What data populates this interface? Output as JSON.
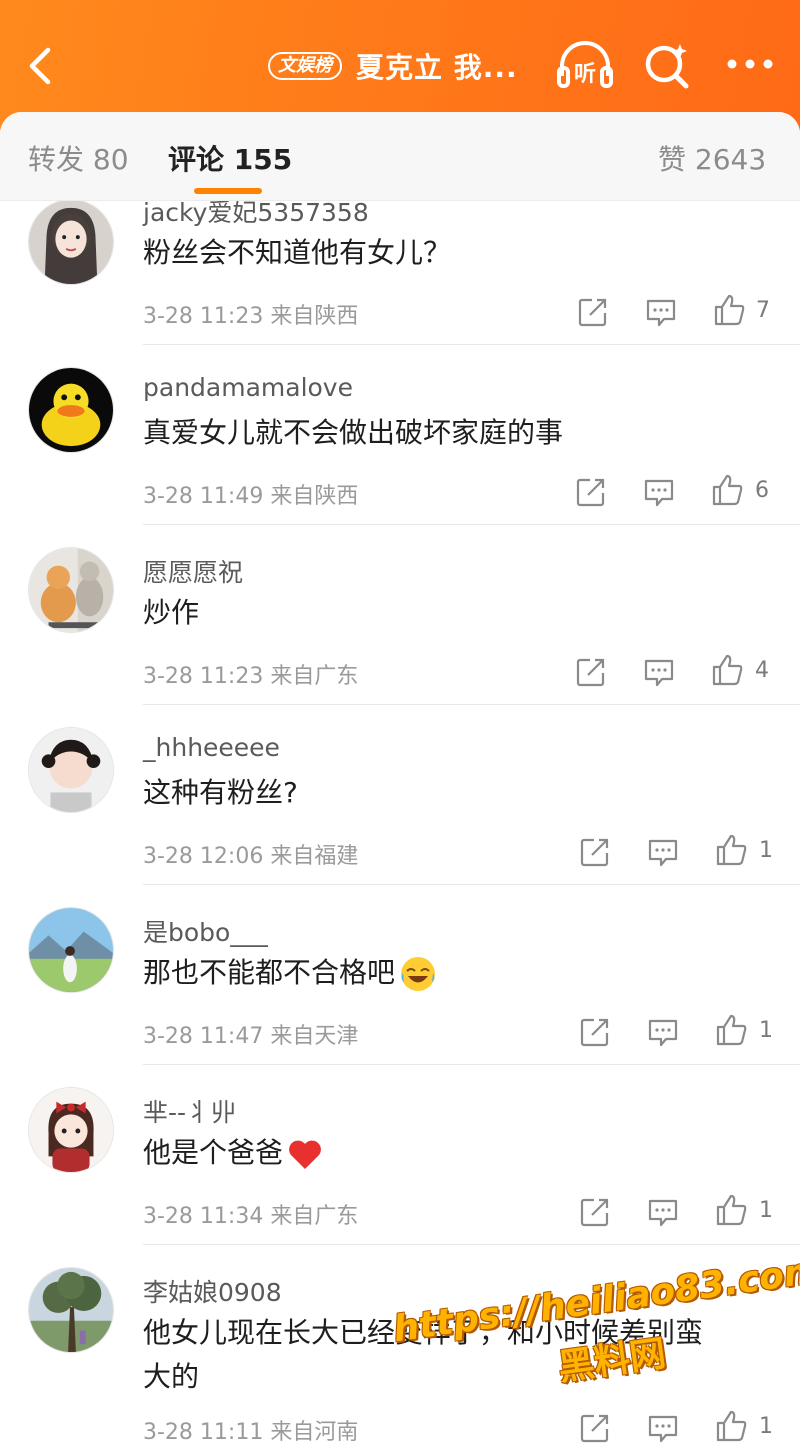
{
  "header": {
    "badge": "文娱榜",
    "title": "夏克立 我...",
    "listen_label": "听",
    "icons": [
      "back-icon",
      "headphones-icon",
      "search-icon",
      "more-icon"
    ],
    "gradient_colors": [
      "#ff8a1c",
      "#ff6a16"
    ]
  },
  "tabs": {
    "repost": "转发 80",
    "comments": "评论 155",
    "likes": "赞 2643",
    "active": "comments",
    "accent": "#ff8200"
  },
  "comments": [
    {
      "user": "jacky爱妃5357358",
      "text": "粉丝会不知道他有女儿？",
      "time": "3-28 11:23",
      "loc": "来自陕西",
      "likes": "7"
    },
    {
      "user": "pandamamalove",
      "text": "真爱女儿就不会做出破坏家庭的事",
      "time": "3-28 11:49",
      "loc": "来自陕西",
      "likes": "6"
    },
    {
      "user": "愿愿愿祝",
      "text": "炒作",
      "time": "3-28 11:23",
      "loc": "来自广东",
      "likes": "4"
    },
    {
      "user": "_hhheeeee",
      "text": "这种有粉丝?",
      "time": "3-28 12:06",
      "loc": "来自福建",
      "likes": "1"
    },
    {
      "user": "是bobo___",
      "text": "那也不能都不合格吧",
      "time": "3-28 11:47",
      "loc": "来自天津",
      "likes": "1"
    },
    {
      "user": "芈--丬丱",
      "text": "他是个爸爸",
      "time": "3-28 11:34",
      "loc": "来自广东",
      "likes": "1"
    },
    {
      "user": "李姑娘0908",
      "text": "他女儿现在长大已经变样了，和小时候差别蛮",
      "text2": "大的",
      "time": "3-28 11:11",
      "loc": "来自河南",
      "likes": "1"
    }
  ],
  "watermark": {
    "url": "https://heiliao83.com",
    "brand": "黑料网"
  }
}
